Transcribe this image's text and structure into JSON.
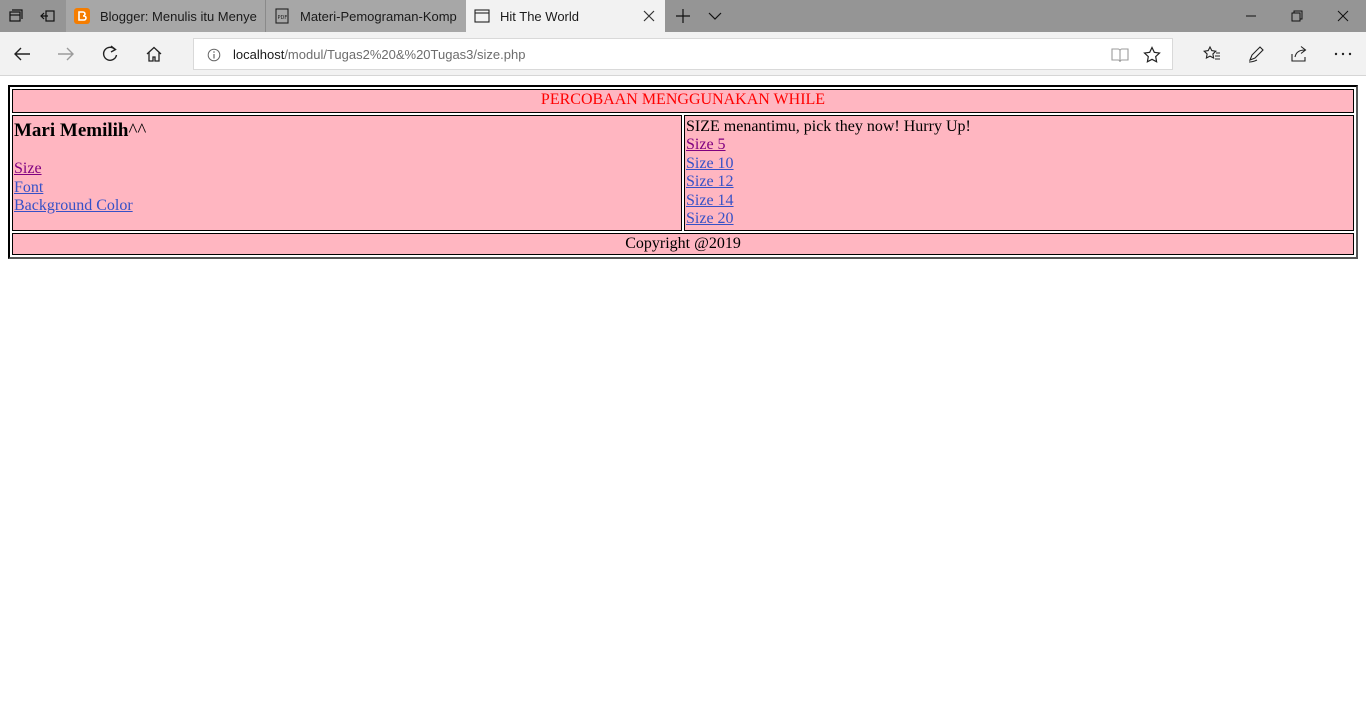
{
  "browser": {
    "tabs": [
      {
        "title": "Blogger: Menulis itu Menye",
        "icon": "blogger-icon",
        "active": false
      },
      {
        "title": "Materi-Pemograman-Komp",
        "icon": "pdf-icon",
        "active": false
      },
      {
        "title": "Hit The World",
        "icon": "page-icon",
        "active": true
      }
    ],
    "url_host": "localhost",
    "url_path": "/modul/Tugas2%20&%20Tugas3/size.php",
    "accent": "#f57d00"
  },
  "page": {
    "header": "PERCOBAAN MENGGUNAKAN WHILE",
    "menu_title": "Mari Memilih",
    "menu_title_suffix": "^^",
    "menu_links": [
      "Size",
      "Font",
      "Background Color"
    ],
    "intro": "SIZE menantimu, pick they now! Hurry Up!",
    "size_links": [
      "Size 5",
      "Size 10",
      "Size 12",
      "Size 14",
      "Size 20"
    ],
    "footer": "Copyright @2019",
    "colors": {
      "cell_bg": "#ffb6c1",
      "header_text": "#ff0000",
      "link": "#3651c7",
      "visited_link": "#800080"
    }
  }
}
